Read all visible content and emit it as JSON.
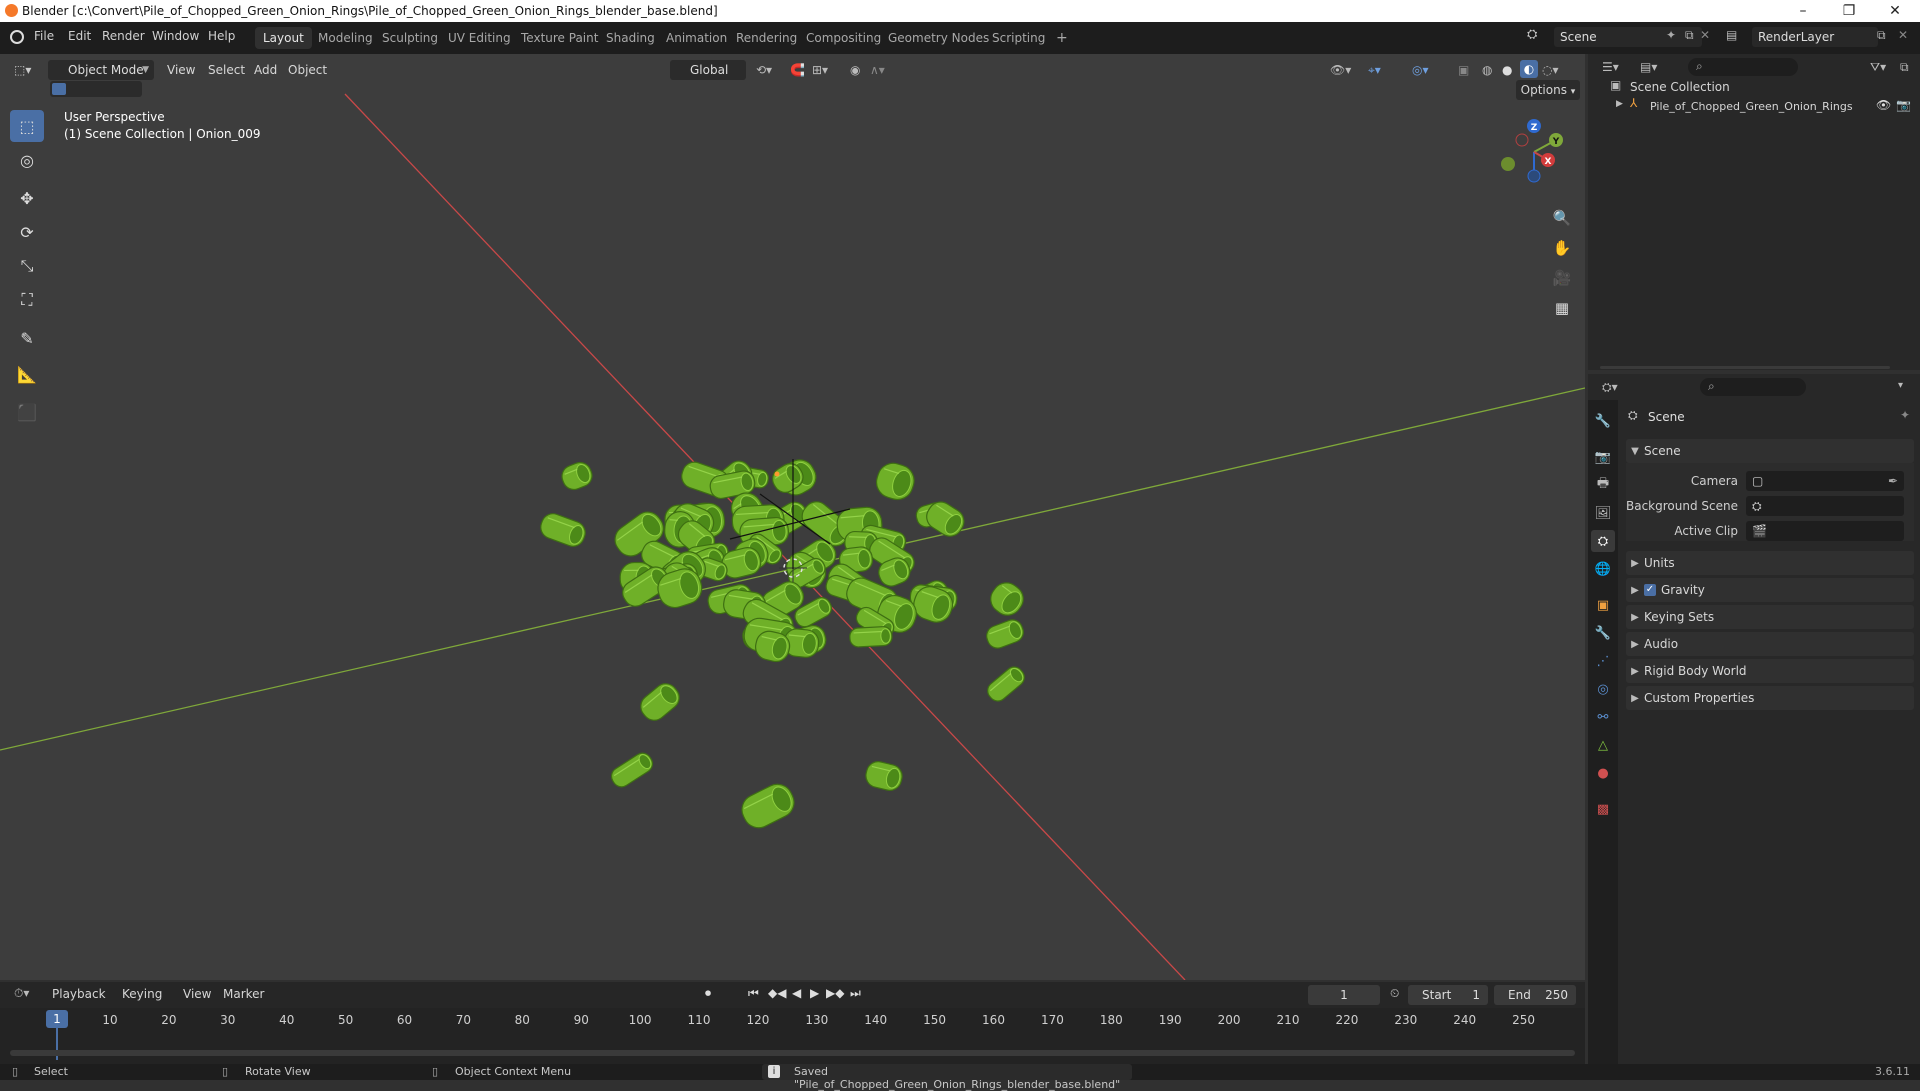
{
  "window": {
    "title": "Blender [c:\\Convert\\Pile_of_Chopped_Green_Onion_Rings\\Pile_of_Chopped_Green_Onion_Rings_blender_base.blend]",
    "minimize": "–",
    "maximize": "❐",
    "close": "✕"
  },
  "menubar": {
    "menus": [
      "File",
      "Edit",
      "Render",
      "Window",
      "Help"
    ],
    "workspaces": [
      "Layout",
      "Modeling",
      "Sculpting",
      "UV Editing",
      "Texture Paint",
      "Shading",
      "Animation",
      "Rendering",
      "Compositing",
      "Geometry Nodes",
      "Scripting"
    ],
    "active_workspace": "Layout",
    "add_tab": "+",
    "scene_name": "Scene",
    "view_layer": "RenderLayer"
  },
  "viewport": {
    "mode": "Object Mode",
    "menus": [
      "View",
      "Select",
      "Add",
      "Object"
    ],
    "transform_orientation": "Global",
    "options_label": "Options",
    "overlay_line1": "User Perspective",
    "overlay_line2": "(1) Scene Collection | Onion_009",
    "gizmo": {
      "x": "X",
      "y": "Y",
      "z": "Z"
    },
    "colors": {
      "x_axis": "#c84848",
      "y_axis": "#7fa83a",
      "onion": "#6fb028",
      "active_tool": "#4a6fa5"
    }
  },
  "outliner": {
    "root": "Scene Collection",
    "items": [
      {
        "name": "Pile_of_Chopped_Green_Onion_Rings"
      }
    ]
  },
  "properties": {
    "title": "Scene",
    "section": "Scene",
    "fields": [
      {
        "label": "Camera",
        "value": ""
      },
      {
        "label": "Background Scene",
        "value": ""
      },
      {
        "label": "Active Clip",
        "value": ""
      }
    ],
    "panels": [
      "Units",
      "Gravity",
      "Keying Sets",
      "Audio",
      "Rigid Body World",
      "Custom Properties"
    ],
    "gravity_checked": true
  },
  "timeline": {
    "menus": [
      "Playback",
      "Keying",
      "View",
      "Marker"
    ],
    "current_frame": "1",
    "start_label": "Start",
    "start": "1",
    "end_label": "End",
    "end": "250",
    "ticks": [
      "10",
      "20",
      "30",
      "40",
      "50",
      "60",
      "70",
      "80",
      "90",
      "100",
      "110",
      "120",
      "130",
      "140",
      "150",
      "160",
      "170",
      "180",
      "190",
      "200",
      "210",
      "220",
      "230",
      "240",
      "250"
    ],
    "playhead": "1"
  },
  "statusbar": {
    "select": "Select",
    "rotate": "Rotate View",
    "context": "Object Context Menu",
    "message": "Saved \"Pile_of_Chopped_Green_Onion_Rings_blender_base.blend\"",
    "version": "3.6.11"
  }
}
